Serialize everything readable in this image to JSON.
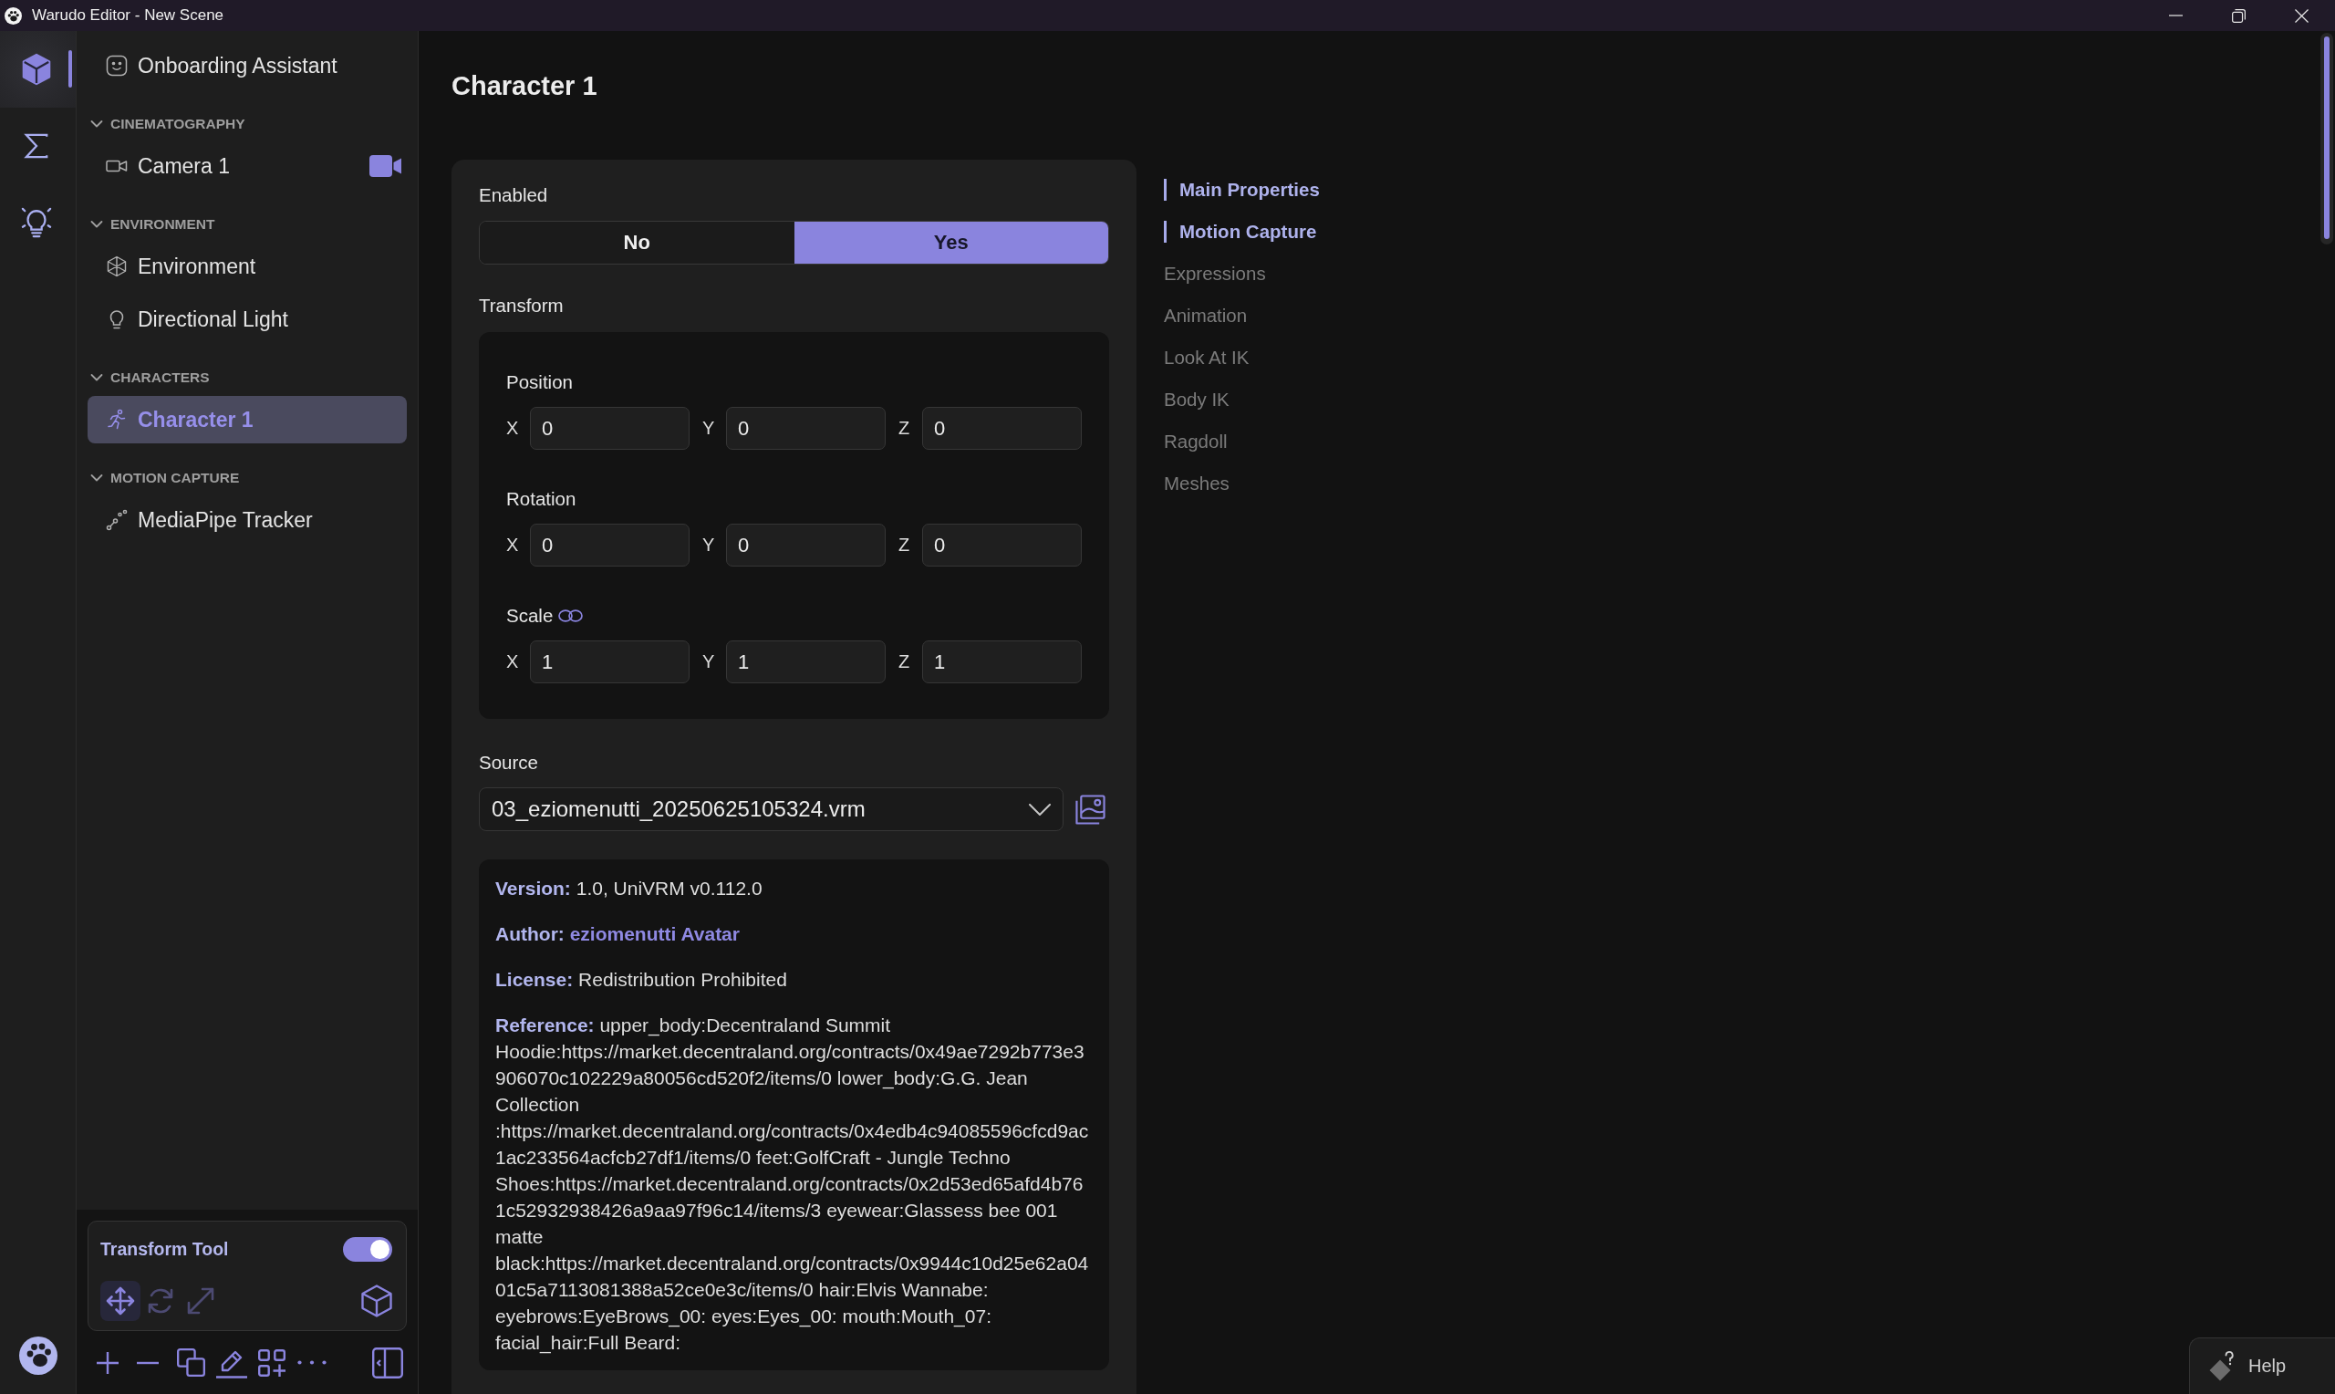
{
  "window": {
    "title": "Warudo Editor - New Scene"
  },
  "activity_bar": [
    {
      "kind": "scene",
      "selected": true
    },
    {
      "kind": "blueprints",
      "selected": false
    },
    {
      "kind": "tips",
      "selected": false
    }
  ],
  "sidebar": {
    "top_item": {
      "label": "Onboarding Assistant"
    },
    "groups": [
      {
        "heading": "CINEMATOGRAPHY",
        "expanded": true,
        "items": [
          {
            "label": "Camera 1",
            "kind": "camera",
            "selected": false,
            "main_camera": true
          }
        ]
      },
      {
        "heading": "ENVIRONMENT",
        "expanded": true,
        "items": [
          {
            "label": "Environment",
            "kind": "environment",
            "selected": false
          },
          {
            "label": "Directional Light",
            "kind": "light",
            "selected": false
          }
        ]
      },
      {
        "heading": "CHARACTERS",
        "expanded": true,
        "items": [
          {
            "label": "Character 1",
            "kind": "character",
            "selected": true
          }
        ]
      },
      {
        "heading": "MOTION CAPTURE",
        "expanded": true,
        "items": [
          {
            "label": "MediaPipe Tracker",
            "kind": "tracker",
            "selected": false
          }
        ]
      }
    ]
  },
  "transform_tool": {
    "label": "Transform Tool",
    "on": true,
    "modes": [
      {
        "kind": "move",
        "selected": true
      },
      {
        "kind": "rotate",
        "selected": false
      },
      {
        "kind": "scale",
        "selected": false
      }
    ]
  },
  "inspector": {
    "title": "Character 1",
    "enabled": {
      "label": "Enabled",
      "options": [
        {
          "label": "No",
          "selected": false
        },
        {
          "label": "Yes",
          "selected": true
        }
      ]
    },
    "transform": {
      "label": "Transform",
      "groups": [
        {
          "label": "Position",
          "linked": false,
          "fields": [
            {
              "axis": "X",
              "value": "0"
            },
            {
              "axis": "Y",
              "value": "0"
            },
            {
              "axis": "Z",
              "value": "0"
            }
          ]
        },
        {
          "label": "Rotation",
          "linked": false,
          "fields": [
            {
              "axis": "X",
              "value": "0"
            },
            {
              "axis": "Y",
              "value": "0"
            },
            {
              "axis": "Z",
              "value": "0"
            }
          ]
        },
        {
          "label": "Scale",
          "linked": true,
          "fields": [
            {
              "axis": "X",
              "value": "1"
            },
            {
              "axis": "Y",
              "value": "1"
            },
            {
              "axis": "Z",
              "value": "1"
            }
          ]
        }
      ]
    },
    "source": {
      "label": "Source",
      "value": "03_eziomenutti_20250625105324.vrm"
    },
    "metadata": [
      {
        "kind": "text",
        "text": "**Version:** 1.0, UniVRM v0.112.0"
      },
      {
        "kind": "link",
        "label": "Author:",
        "link": "eziomenutti Avatar"
      },
      {
        "kind": "text",
        "text": "**License:** Redistribution Prohibited"
      },
      {
        "kind": "text",
        "text": "**Reference:** upper_body:Decentraland Summit Hoodie:https://market.decentraland.org/contracts/0x49ae7292b773e3906070c102229a80056cd520f2/items/0 lower_body:G.G. Jean Collection :https://market.decentraland.org/contracts/0x4edb4c94085596cfcd9ac1ac233564acfcb27df1/items/0 feet:GolfCraft - Jungle Techno Shoes:https://market.decentraland.org/contracts/0x2d53ed65afd4b761c52932938426a9aa97f96c14/items/3 eyewear:Glassess bee 001 matte black:https://market.decentraland.org/contracts/0x9944c10d25e62a0401c5a7113081388a52ce0e3c/items/0 hair:Elvis Wannabe: eyebrows:EyeBrows_00: eyes:Eyes_00: mouth:Mouth_07: facial_hair:Full Beard:"
      }
    ]
  },
  "section_nav": [
    {
      "label": "Main Properties",
      "selected": true
    },
    {
      "label": "Motion Capture",
      "selected": true
    },
    {
      "label": "Expressions",
      "selected": false
    },
    {
      "label": "Animation",
      "selected": false
    },
    {
      "label": "Look At IK",
      "selected": false
    },
    {
      "label": "Body IK",
      "selected": false
    },
    {
      "label": "Ragdoll",
      "selected": false
    },
    {
      "label": "Meshes",
      "selected": false
    }
  ],
  "help_button": {
    "label": "Help"
  }
}
